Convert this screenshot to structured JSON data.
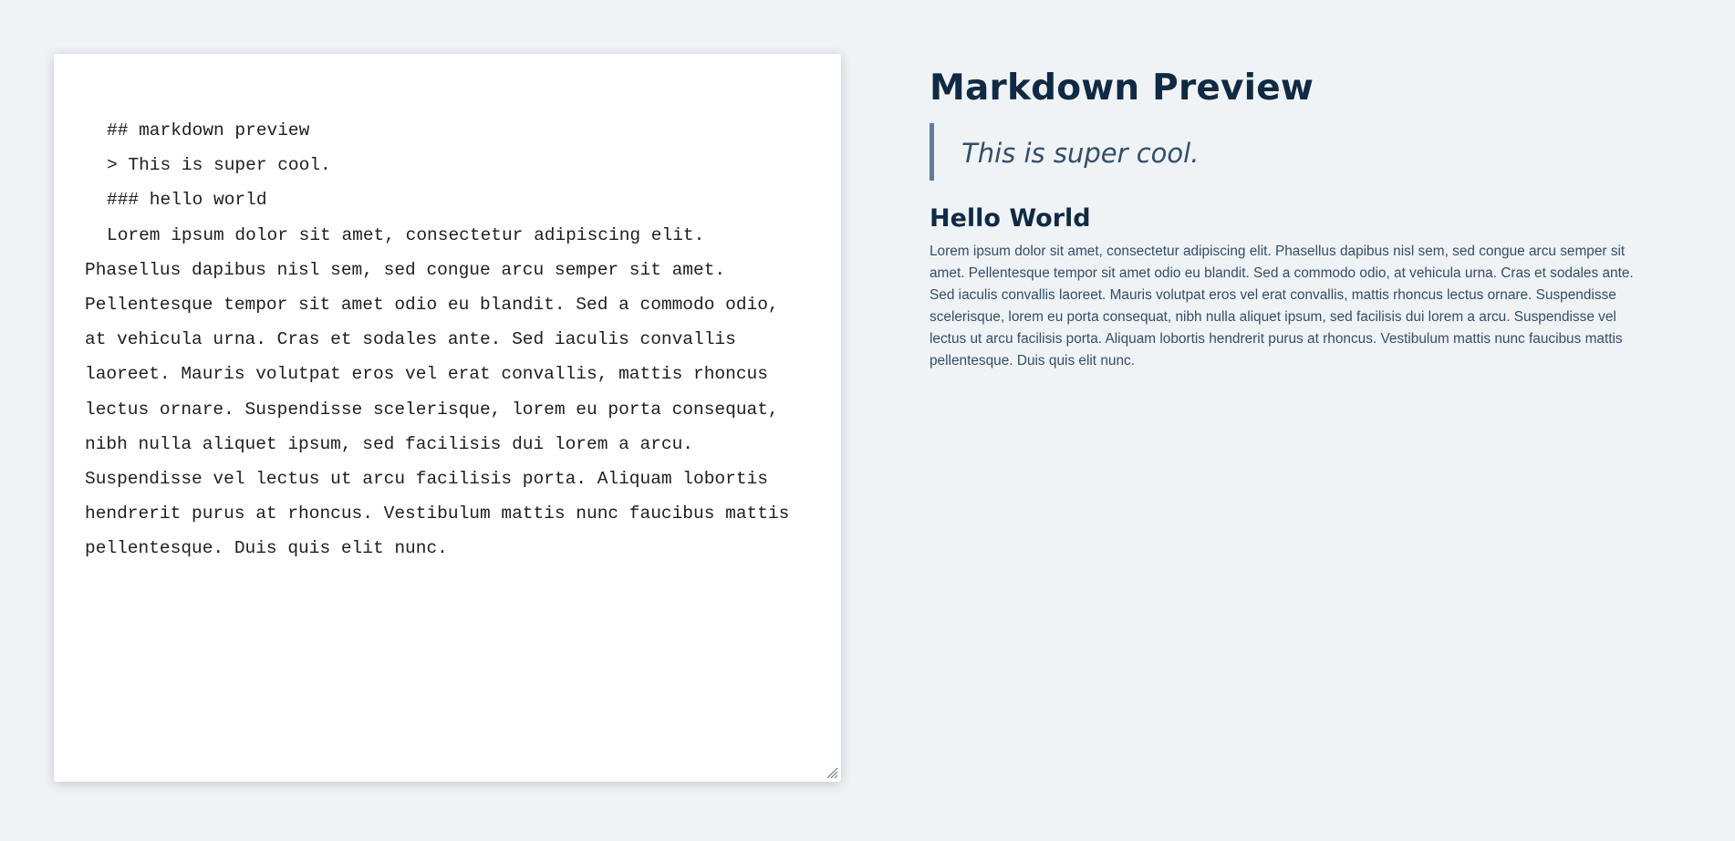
{
  "editor": {
    "lines": [
      "## markdown preview",
      "> This is super cool.",
      "### hello world",
      "Lorem ipsum dolor sit amet, consectetur adipiscing elit. Phasellus dapibus nisl sem, sed congue arcu semper sit amet. Pellentesque tempor sit amet odio eu blandit. Sed a commodo odio, at vehicula urna. Cras et sodales ante. Sed iaculis convallis laoreet. Mauris volutpat eros vel erat convallis, mattis rhoncus lectus ornare. Suspendisse scelerisque, lorem eu porta consequat, nibh nulla aliquet ipsum, sed facilisis dui lorem a arcu. Suspendisse vel lectus ut arcu facilisis porta. Aliquam lobortis hendrerit purus at rhoncus. Vestibulum mattis nunc faucibus mattis pellentesque. Duis quis elit nunc."
    ],
    "resize_icon": "resize-grip-icon"
  },
  "preview": {
    "title": "Markdown Preview",
    "quote": "This is super cool.",
    "subheading": "Hello World",
    "paragraph": "Lorem ipsum dolor sit amet, consectetur adipiscing elit. Phasellus dapibus nisl sem, sed congue arcu semper sit amet. Pellentesque tempor sit amet odio eu blandit. Sed a commodo odio, at vehicula urna. Cras et sodales ante. Sed iaculis convallis laoreet. Mauris volutpat eros vel erat convallis, mattis rhoncus lectus ornare. Suspendisse scelerisque, lorem eu porta consequat, nibh nulla aliquet ipsum, sed facilisis dui lorem a arcu. Suspendisse vel lectus ut arcu facilisis porta. Aliquam lobortis hendrerit purus at rhoncus. Vestibulum mattis nunc faucibus mattis pellentesque. Duis quis elit nunc."
  },
  "colors": {
    "background": "#f0f3f6",
    "heading": "#102a43",
    "quote_border": "#627d98",
    "body_text": "#334e68"
  }
}
